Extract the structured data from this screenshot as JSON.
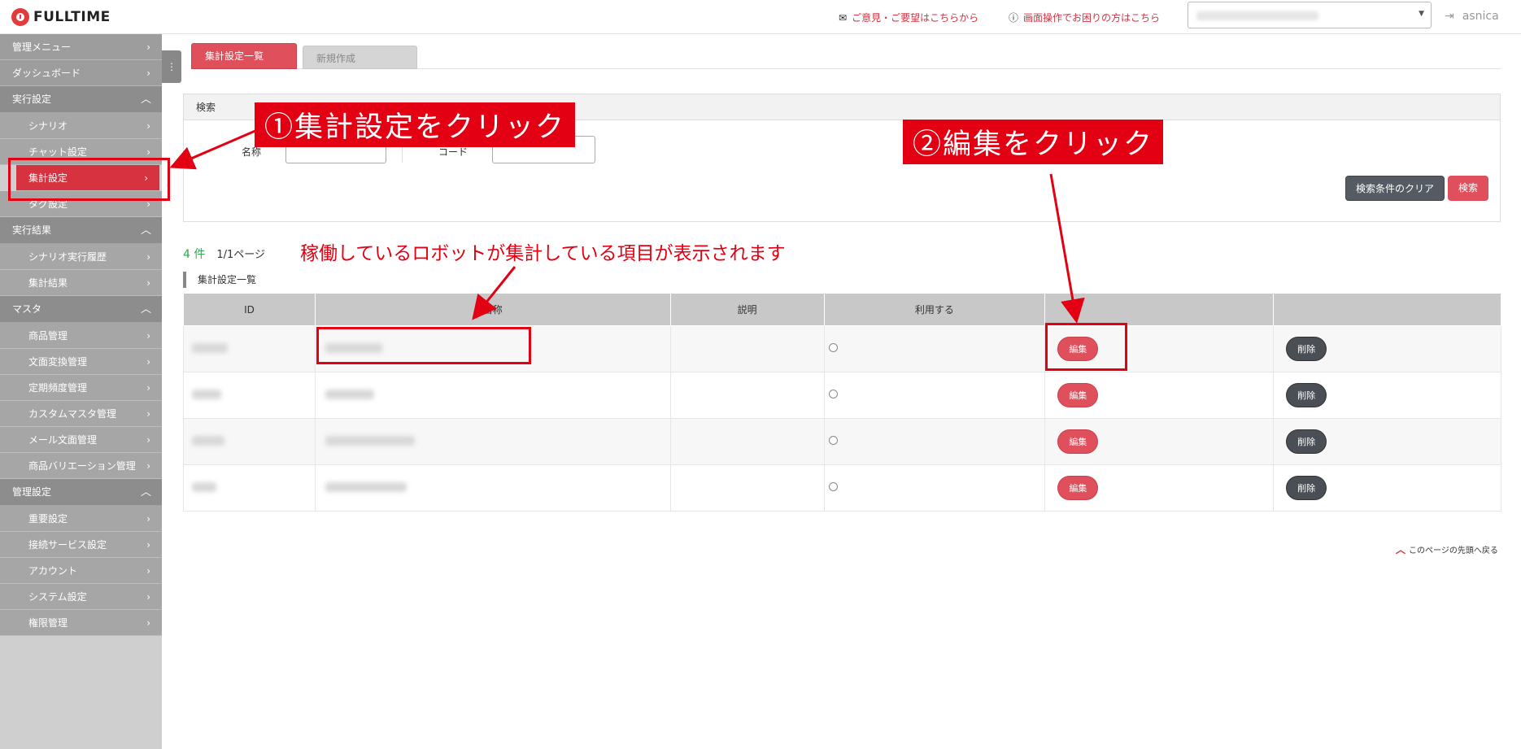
{
  "header": {
    "logo_text": "FULLTIME",
    "feedback_link": "ご意見・ご要望はこちらから",
    "help_link": "画面操作でお困りの方はこちら",
    "username": "asnica"
  },
  "sidebar": {
    "top_items": [
      "管理メニュー",
      "ダッシュボード"
    ],
    "sections": [
      {
        "title": "実行設定",
        "items": [
          "シナリオ",
          "チャット設定",
          "集計設定",
          "タグ設定"
        ]
      },
      {
        "title": "実行結果",
        "items": [
          "シナリオ実行履歴",
          "集計結果"
        ]
      },
      {
        "title": "マスタ",
        "items": [
          "商品管理",
          "文面変換管理",
          "定期頻度管理",
          "カスタムマスタ管理",
          "メール文面管理",
          "商品バリエーション管理"
        ]
      },
      {
        "title": "管理設定",
        "items": [
          "重要設定",
          "接続サービス設定",
          "アカウント",
          "システム設定",
          "権限管理"
        ]
      }
    ]
  },
  "tabs": [
    "集計設定一覧",
    "新規作成"
  ],
  "search": {
    "title": "検索",
    "name_label": "名称",
    "code_label": "コード",
    "clear_button": "検索条件のクリア",
    "search_button": "検索"
  },
  "results": {
    "count": "4 件",
    "page": "1/1ページ",
    "list_title": "集計設定一覧",
    "columns": [
      "ID",
      "名称",
      "説明",
      "利用する",
      "",
      ""
    ],
    "edit_label": "編集",
    "delete_label": "削除",
    "row_count": 4
  },
  "back_to_top": "このページの先頭へ戻る",
  "annotations": {
    "step1": "①集計設定をクリック",
    "step2": "②編集をクリック",
    "note": "稼働しているロボットが集計している項目が表示されます"
  },
  "colors": {
    "accent": "#e0505c",
    "annotation": "#e30013",
    "sidebar": "#9d9d9d",
    "count_green": "#2fa84f"
  }
}
